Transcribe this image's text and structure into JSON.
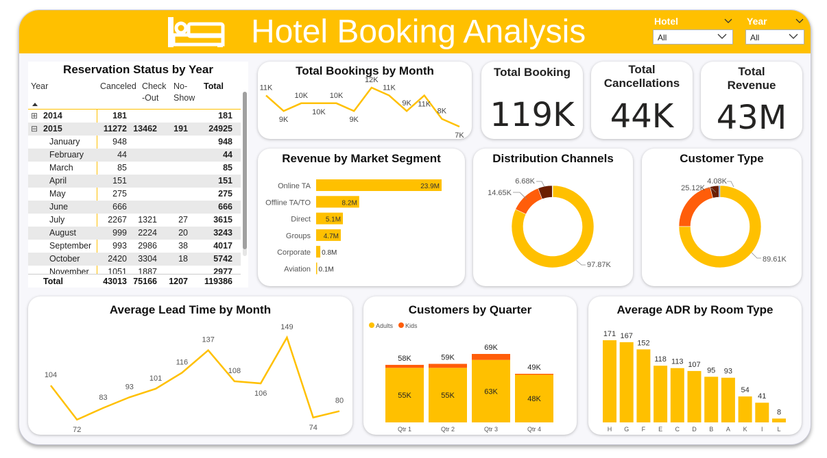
{
  "header": {
    "title": "Hotel Booking Analysis",
    "hotel_slicer": {
      "label": "Hotel",
      "value": "All"
    },
    "year_slicer": {
      "label": "Year",
      "value": "All"
    }
  },
  "kpis": {
    "total_booking": {
      "label": "Total Booking",
      "value": "119K"
    },
    "total_cancellations": {
      "label": "Total Cancellations",
      "value": "44K"
    },
    "total_revenue": {
      "label": "Total Revenue",
      "value": "43M"
    }
  },
  "reservation_table": {
    "title": "Reservation Status by Year",
    "columns": {
      "year": "Year",
      "canceled": "Canceled",
      "checkout": "Check -Out",
      "noshow": "No- Show",
      "total": "Total"
    },
    "rows": [
      {
        "label": "2014",
        "expand": "⊞",
        "canceled": "181",
        "checkout": "",
        "noshow": "",
        "total": "181",
        "level": 0
      },
      {
        "label": "2015",
        "expand": "⊟",
        "canceled": "11272",
        "checkout": "13462",
        "noshow": "191",
        "total": "24925",
        "level": 0
      },
      {
        "label": "January",
        "canceled": "948",
        "checkout": "",
        "noshow": "",
        "total": "948",
        "level": 1
      },
      {
        "label": "February",
        "canceled": "44",
        "checkout": "",
        "noshow": "",
        "total": "44",
        "level": 1
      },
      {
        "label": "March",
        "canceled": "85",
        "checkout": "",
        "noshow": "",
        "total": "85",
        "level": 1
      },
      {
        "label": "April",
        "canceled": "151",
        "checkout": "",
        "noshow": "",
        "total": "151",
        "level": 1
      },
      {
        "label": "May",
        "canceled": "275",
        "checkout": "",
        "noshow": "",
        "total": "275",
        "level": 1
      },
      {
        "label": "June",
        "canceled": "666",
        "checkout": "",
        "noshow": "",
        "total": "666",
        "level": 1
      },
      {
        "label": "July",
        "canceled": "2267",
        "checkout": "1321",
        "noshow": "27",
        "total": "3615",
        "level": 1
      },
      {
        "label": "August",
        "canceled": "999",
        "checkout": "2224",
        "noshow": "20",
        "total": "3243",
        "level": 1
      },
      {
        "label": "September",
        "canceled": "993",
        "checkout": "2986",
        "noshow": "38",
        "total": "4017",
        "level": 1
      },
      {
        "label": "October",
        "canceled": "2420",
        "checkout": "3304",
        "noshow": "18",
        "total": "5742",
        "level": 1
      },
      {
        "label": "November",
        "canceled": "1051",
        "checkout": "1887",
        "noshow": "",
        "total": "2977",
        "level": 1
      }
    ],
    "total_row": {
      "label": "Total",
      "canceled": "43013",
      "checkout": "75166",
      "noshow": "1207",
      "total": "119386"
    }
  },
  "charts": {
    "bookings_title": "Total Bookings by Month",
    "revenue_title": "Revenue by Market Segment",
    "channels_title": "Distribution Channels",
    "customer_type_title": "Customer Type",
    "lead_time_title": "Average Lead Time by Month",
    "quarter_title": "Customers by Quarter",
    "adr_title": "Average ADR by Room Type"
  },
  "colors": {
    "accent": "#ffc000",
    "secondary": "#ff5d0a",
    "dark": "#6b1e00",
    "blue": "#2b6cb0"
  },
  "chart_data": [
    {
      "type": "line",
      "id": "bookings",
      "values": [
        11,
        9,
        10,
        10,
        10,
        9,
        12,
        11,
        9,
        11,
        8,
        7
      ],
      "labels": [
        "11K",
        "9K",
        "10K",
        "10K",
        "10K",
        "9K",
        "12K",
        "11K",
        "9K",
        "11K",
        "8K",
        "7K"
      ]
    },
    {
      "type": "bar",
      "id": "revenue",
      "categories": [
        "Online TA",
        "Offline TA/TO",
        "Direct",
        "Groups",
        "Corporate",
        "Aviation"
      ],
      "values": [
        23.9,
        8.2,
        5.1,
        4.7,
        0.8,
        0.1
      ],
      "labels": [
        "23.9M",
        "8.2M",
        "5.1M",
        "4.7M",
        "0.8M",
        "0.1M"
      ]
    },
    {
      "type": "pie",
      "id": "channels",
      "values": [
        97.87,
        14.65,
        6.68,
        0.24
      ],
      "labels": [
        "97.87K",
        "14.65K",
        "6.68K",
        ""
      ]
    },
    {
      "type": "pie",
      "id": "customer_type",
      "values": [
        89.61,
        25.12,
        4.08,
        0.58
      ],
      "labels": [
        "89.61K",
        "25.12K",
        "4.08K",
        ""
      ]
    },
    {
      "type": "line",
      "id": "lead_time",
      "values": [
        104,
        72,
        83,
        93,
        101,
        116,
        137,
        108,
        106,
        149,
        74,
        80
      ],
      "labels": [
        "104",
        "72",
        "83",
        "93",
        "101",
        "116",
        "137",
        "108",
        "106",
        "149",
        "74",
        "80"
      ]
    },
    {
      "type": "bar",
      "id": "quarter",
      "categories": [
        "Qtr 1",
        "Qtr 2",
        "Qtr 3",
        "Qtr 4"
      ],
      "series": [
        {
          "name": "Adults",
          "values": [
            55,
            55,
            63,
            48
          ],
          "labels": [
            "55K",
            "55K",
            "63K",
            "48K"
          ]
        },
        {
          "name": "Kids",
          "values": [
            3,
            4,
            6,
            1
          ]
        }
      ],
      "totals": [
        "58K",
        "59K",
        "69K",
        "49K"
      ],
      "total_values": [
        58,
        59,
        69,
        49
      ]
    },
    {
      "type": "bar",
      "id": "adr",
      "categories": [
        "H",
        "G",
        "F",
        "E",
        "C",
        "D",
        "B",
        "A",
        "K",
        "I",
        "L"
      ],
      "values": [
        171,
        167,
        152,
        118,
        113,
        107,
        95,
        93,
        54,
        41,
        8
      ]
    }
  ]
}
